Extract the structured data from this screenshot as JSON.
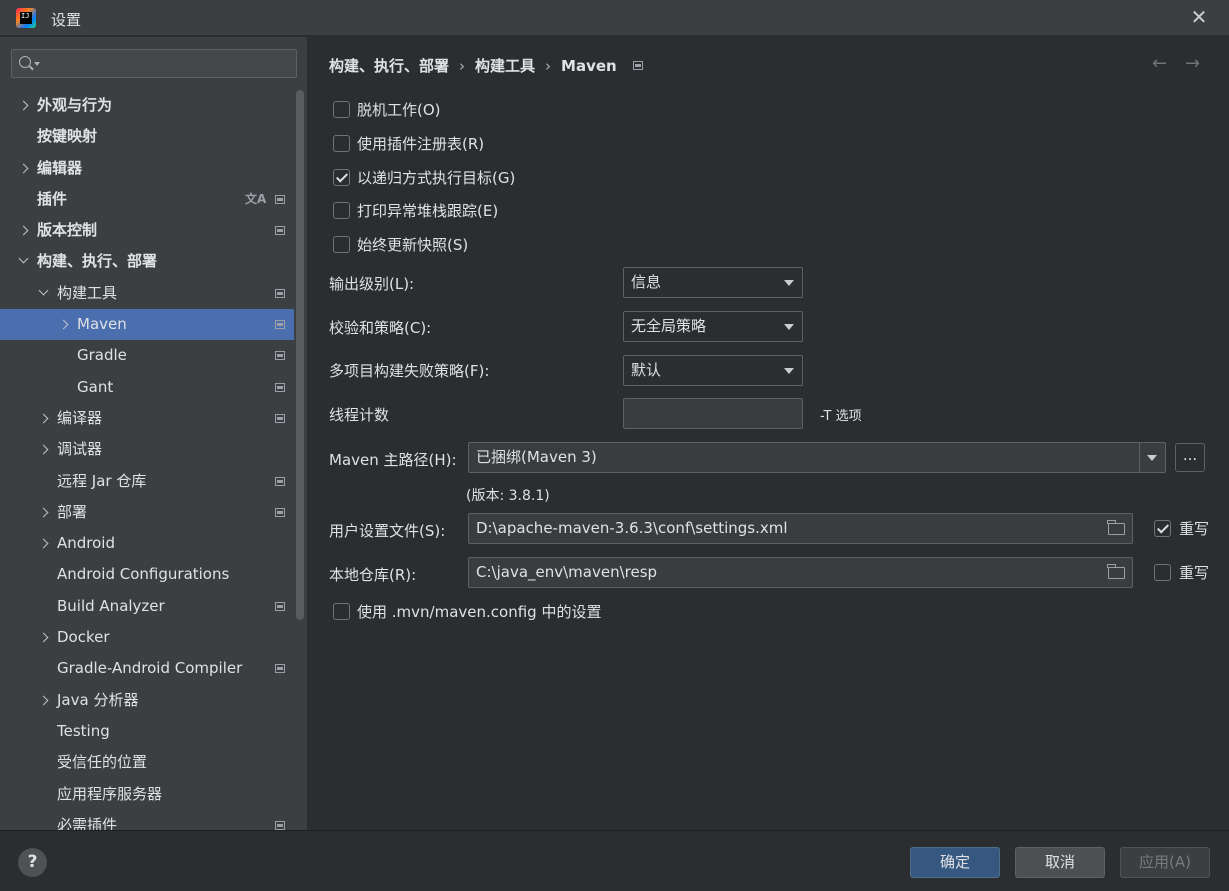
{
  "window": {
    "title": "设置"
  },
  "search": {
    "value": "",
    "placeholder": ""
  },
  "sidebar": {
    "items": [
      {
        "label": "外观与行为",
        "bold": true,
        "chevron": "right",
        "indent": 0,
        "pg": false
      },
      {
        "label": "按键映射",
        "bold": true,
        "chevron": "none",
        "indent": 0,
        "pg": false
      },
      {
        "label": "编辑器",
        "bold": true,
        "chevron": "right",
        "indent": 0,
        "pg": false
      },
      {
        "label": "插件",
        "bold": true,
        "chevron": "none",
        "indent": 0,
        "pg": true,
        "translate": true
      },
      {
        "label": "版本控制",
        "bold": true,
        "chevron": "right",
        "indent": 0,
        "pg": true
      },
      {
        "label": "构建、执行、部署",
        "bold": true,
        "chevron": "down",
        "indent": 0,
        "pg": false
      },
      {
        "label": "构建工具",
        "bold": false,
        "chevron": "down",
        "indent": 1,
        "pg": true
      },
      {
        "label": "Maven",
        "bold": false,
        "chevron": "right",
        "indent": 2,
        "pg": true,
        "selected": true
      },
      {
        "label": "Gradle",
        "bold": false,
        "chevron": "none",
        "indent": 2,
        "pg": true
      },
      {
        "label": "Gant",
        "bold": false,
        "chevron": "none",
        "indent": 2,
        "pg": true
      },
      {
        "label": "编译器",
        "bold": false,
        "chevron": "right",
        "indent": 1,
        "pg": true
      },
      {
        "label": "调试器",
        "bold": false,
        "chevron": "right",
        "indent": 1,
        "pg": false
      },
      {
        "label": "远程 Jar 仓库",
        "bold": false,
        "chevron": "none",
        "indent": 1,
        "pg": true
      },
      {
        "label": "部署",
        "bold": false,
        "chevron": "right",
        "indent": 1,
        "pg": true
      },
      {
        "label": "Android",
        "bold": false,
        "chevron": "right",
        "indent": 1,
        "pg": false
      },
      {
        "label": "Android Configurations",
        "bold": false,
        "chevron": "none",
        "indent": 1,
        "pg": false
      },
      {
        "label": "Build Analyzer",
        "bold": false,
        "chevron": "none",
        "indent": 1,
        "pg": true
      },
      {
        "label": "Docker",
        "bold": false,
        "chevron": "right",
        "indent": 1,
        "pg": false
      },
      {
        "label": "Gradle-Android Compiler",
        "bold": false,
        "chevron": "none",
        "indent": 1,
        "pg": true
      },
      {
        "label": "Java 分析器",
        "bold": false,
        "chevron": "right",
        "indent": 1,
        "pg": false
      },
      {
        "label": "Testing",
        "bold": false,
        "chevron": "none",
        "indent": 1,
        "pg": false
      },
      {
        "label": "受信任的位置",
        "bold": false,
        "chevron": "none",
        "indent": 1,
        "pg": false
      },
      {
        "label": "应用程序服务器",
        "bold": false,
        "chevron": "none",
        "indent": 1,
        "pg": false
      },
      {
        "label": "必需插件",
        "bold": false,
        "chevron": "none",
        "indent": 1,
        "pg": true
      }
    ]
  },
  "breadcrumb": {
    "part1": "构建、执行、部署",
    "part2": "构建工具",
    "part3": "Maven"
  },
  "options": {
    "offline": {
      "label": "脱机工作(O)",
      "checked": false
    },
    "plugin_registry": {
      "label": "使用插件注册表(R)",
      "checked": false
    },
    "recursive": {
      "label": "以递归方式执行目标(G)",
      "checked": true
    },
    "print_stack": {
      "label": "打印异常堆栈跟踪(E)",
      "checked": false
    },
    "always_update": {
      "label": "始终更新快照(S)",
      "checked": false
    }
  },
  "fields": {
    "output_level": {
      "label": "输出级别(L):",
      "value": "信息"
    },
    "checksum": {
      "label": "校验和策略(C):",
      "value": "无全局策略"
    },
    "multiproject": {
      "label": "多项目构建失败策略(F):",
      "value": "默认"
    },
    "threads": {
      "label": "线程计数",
      "value": "",
      "hint": "-T 选项"
    },
    "maven_home": {
      "label": "Maven 主路径(H):",
      "value": "已捆绑(Maven 3)",
      "version": "(版本: 3.8.1)",
      "browse": "..."
    },
    "user_settings": {
      "label": "用户设置文件(S):",
      "value": "D:\\apache-maven-3.6.3\\conf\\settings.xml",
      "override_label": "重写",
      "override": true
    },
    "local_repo": {
      "label": "本地仓库(R):",
      "value": "C:\\java_env\\maven\\resp",
      "override_label": "重写",
      "override": false
    }
  },
  "mvn_config": {
    "label": "使用 .mvn/maven.config 中的设置",
    "checked": false
  },
  "footer": {
    "help": "?",
    "ok": "确定",
    "cancel": "取消",
    "apply": "应用(A)"
  }
}
